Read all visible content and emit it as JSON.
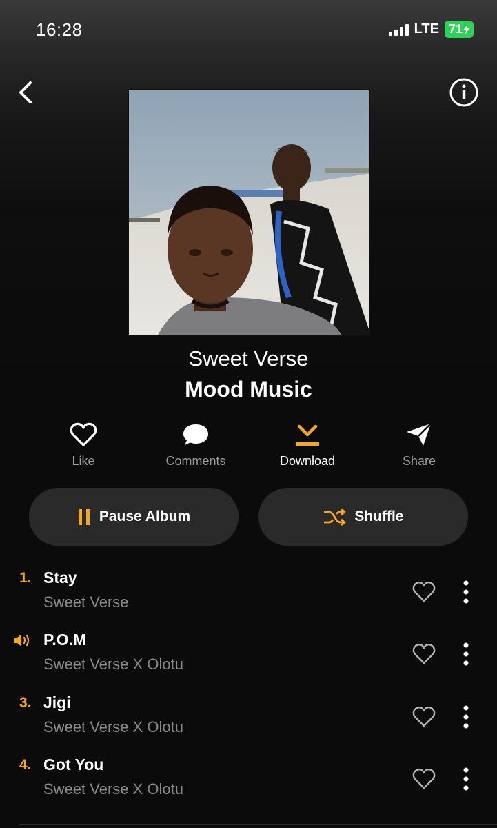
{
  "status": {
    "time": "16:28",
    "network": "LTE",
    "battery": "71"
  },
  "nav": {
    "back_icon": "chevron-left-icon",
    "info_icon": "info-circle-icon"
  },
  "album": {
    "artist": "Sweet Verse",
    "title": "Mood Music"
  },
  "actions": [
    {
      "label": "Like",
      "icon": "heart-outline-icon",
      "active": false
    },
    {
      "label": "Comments",
      "icon": "comment-bubble-icon",
      "active": false
    },
    {
      "label": "Download",
      "icon": "download-icon",
      "active": true
    },
    {
      "label": "Share",
      "icon": "paper-plane-icon",
      "active": false
    }
  ],
  "controls": {
    "pause_label": "Pause Album",
    "shuffle_label": "Shuffle"
  },
  "tracks": [
    {
      "number": "1.",
      "title": "Stay",
      "artist": "Sweet Verse",
      "playing": false
    },
    {
      "number": "",
      "title": "P.O.M",
      "artist": "Sweet Verse X Olotu",
      "playing": true
    },
    {
      "number": "3.",
      "title": "Jigi",
      "artist": "Sweet Verse X Olotu",
      "playing": false
    },
    {
      "number": "4.",
      "title": "Got You",
      "artist": "Sweet Verse X Olotu",
      "playing": false
    }
  ],
  "colors": {
    "accent": "#f5a623",
    "background": "#0b0b0b",
    "pill": "#2a2a2a",
    "muted_text": "#8a8a8a",
    "battery": "#2fd158"
  }
}
